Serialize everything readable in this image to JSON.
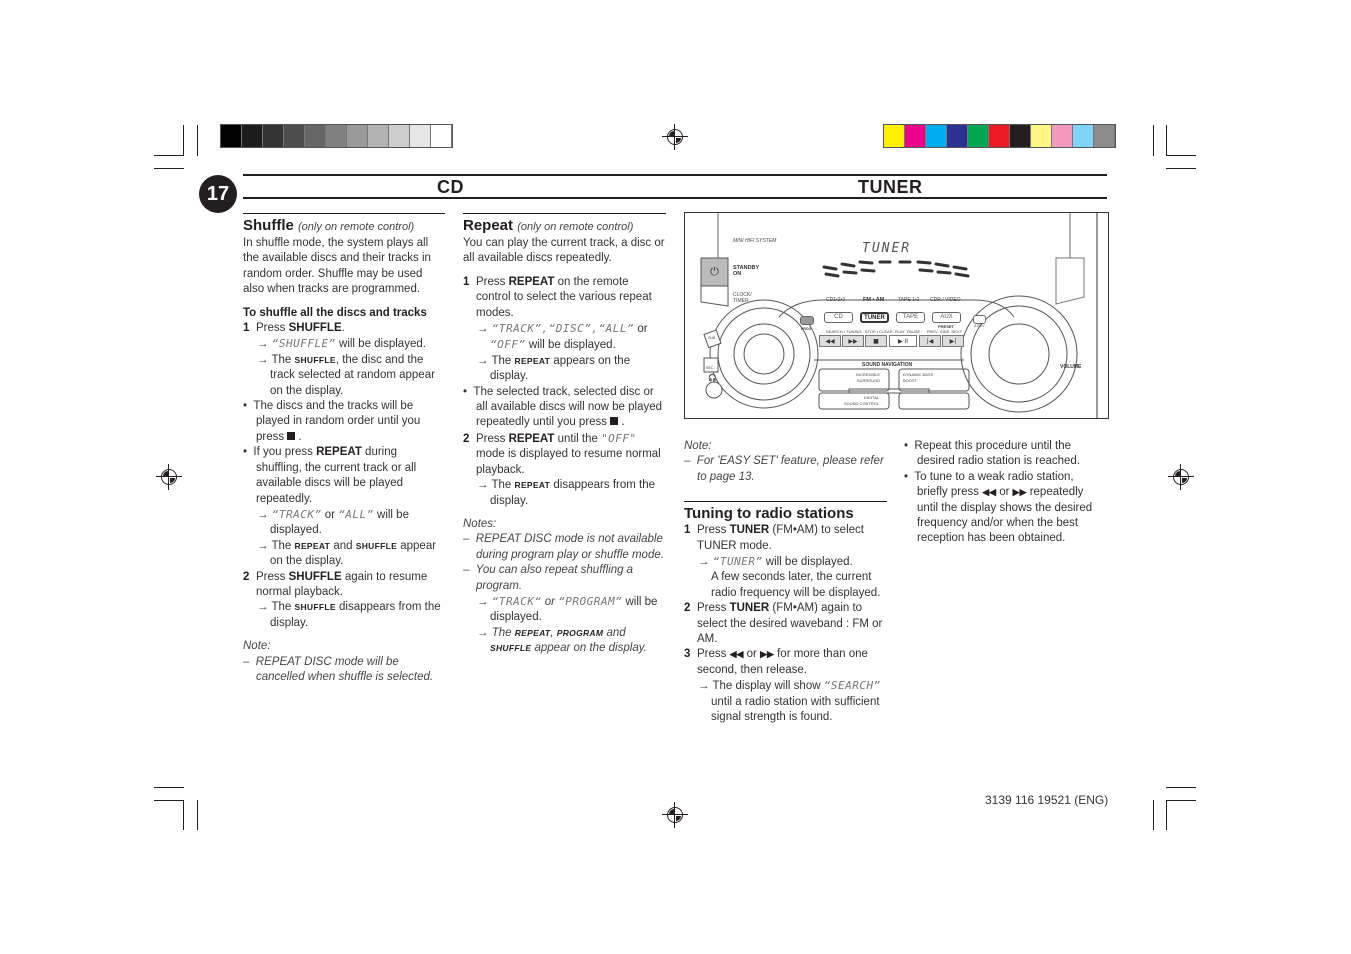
{
  "print_marks": {
    "grayscale_swatches": [
      "#000000",
      "#1c1c1c",
      "#333333",
      "#4d4d4d",
      "#666666",
      "#808080",
      "#999999",
      "#b3b3b3",
      "#cccccc",
      "#e6e6e6",
      "#ffffff"
    ],
    "color_swatches": [
      "#fff200",
      "#ec008c",
      "#00aeef",
      "#2e3192",
      "#00a651",
      "#ed1c24",
      "#231f20",
      "#fff685",
      "#f49ac1",
      "#7fd4f7",
      "#8c8c8c"
    ]
  },
  "header": {
    "page_number": "17",
    "left_title": "CD",
    "right_title": "TUNER"
  },
  "shuffle": {
    "title": "Shuffle",
    "subtitle": "(only on remote control)",
    "intro": "In shuffle mode, the system plays all the available discs and their tracks in random order. Shuffle may be used also when tracks are programmed.",
    "subheading": "To shuffle all the discs and tracks",
    "step1_num": "1",
    "step1_pre": "Press ",
    "step1_key": "SHUFFLE",
    "step1_post": ".",
    "step1_a1_lcd": "“SHUFFLE”",
    "step1_a1_post": " will be displayed.",
    "step1_a2_pre": "The ",
    "step1_a2_sc": "SHUFFLE",
    "step1_a2_post": ", the disc and the track selected at random appear on the display.",
    "bullet1": "The discs and the tracks will be played in random order until you press ",
    "bullet2_pre": "If you press ",
    "bullet2_key": "REPEAT",
    "bullet2_post": " during shuffling, the current track or all available discs will be played repeatedly.",
    "bullet2_a1_lcd1": "“TRACK”",
    "bullet2_a1_or": " or ",
    "bullet2_a1_lcd2": "“ALL”",
    "bullet2_a1_post": " will be displayed.",
    "bullet2_a2_pre": "The ",
    "bullet2_a2_sc1": "REPEAT",
    "bullet2_a2_and": " and ",
    "bullet2_a2_sc2": "SHUFFLE",
    "bullet2_a2_post": " appear on the display.",
    "step2_num": "2",
    "step2_pre": "Press ",
    "step2_key": "SHUFFLE",
    "step2_post": " again to resume normal playback.",
    "step2_a1_pre": "The ",
    "step2_a1_sc": "SHUFFLE",
    "step2_a1_post": " disappears from the display.",
    "note_label": "Note:",
    "note1": "REPEAT DISC mode will be cancelled when shuffle is selected."
  },
  "repeat": {
    "title": "Repeat",
    "subtitle": "(only on remote control)",
    "intro": "You can play the current track, a disc or all available discs repeatedly.",
    "step1_num": "1",
    "step1_pre": "Press ",
    "step1_key": "REPEAT",
    "step1_post": " on the remote control to select the various repeat modes.",
    "step1_a1_lcd": "“TRACK”,“DISC”,“ALL”",
    "step1_a1_or": " or ",
    "step1_a1_lcd2": "“OFF”",
    "step1_a1_post": " will be displayed.",
    "step1_a2_pre": "The ",
    "step1_a2_sc": "REPEAT",
    "step1_a2_post": " appears on the display.",
    "bullet1": "The selected track, selected disc or all available discs will now be played repeatedly until you press ",
    "step2_num": "2",
    "step2_pre": "Press ",
    "step2_key": "REPEAT",
    "step2_mid": " until the ",
    "step2_lcd": "\"OFF\"",
    "step2_post": " mode is displayed to resume normal playback.",
    "step2_a1_pre": "The ",
    "step2_a1_sc": "REPEAT",
    "step2_a1_post": " disappears from the display.",
    "notes_label": "Notes:",
    "note1": "REPEAT DISC mode is not available during program play or shuffle mode.",
    "note2": "You can also repeat shuffling a program.",
    "note2_a1_lcd1": "“TRACK“",
    "note2_a1_or": " or ",
    "note2_a1_lcd2": "“PROGRAM”",
    "note2_a1_post": " will be displayed.",
    "note2_a2_pre": "The ",
    "note2_a2_sc1": "REPEAT",
    "note2_a2_comma": ", ",
    "note2_a2_sc2": "PROGRAM",
    "note2_a2_and": " and ",
    "note2_a2_sc3": "SHUFFLE",
    "note2_a2_post": " appear on the display."
  },
  "device": {
    "brand_text": "MINI HIFI SYSTEM",
    "display_text": "TUNER",
    "standby_label": "STANDBY\nON",
    "clock_label": "CLOCK/\nTIMER",
    "source_labels": [
      "CD1•2•3",
      "FM • AM",
      "TAPE 1•2",
      "CDR / VIDEO"
    ],
    "source_buttons": [
      "CD",
      "TUNER",
      "TAPE",
      "AUX"
    ],
    "prog_label": "PROG",
    "arev_label": "A.REV",
    "preset_label": "PRESET",
    "transport_labels": "SEARCH • TUNING   STOP • CLEAR  PLAY  PAUSE      PREV  SIDE  NEXT",
    "transport_buttons": [
      "◀◀",
      "▶▶",
      "■",
      "▶  II",
      "|◀",
      "▶|"
    ],
    "sound_navigation": "SOUND NAVIGATION",
    "incredible_surround": "INCREDIBLE\nSURROUND",
    "dynamic_bass": "DYNAMIC BASS\nBOOST",
    "digital_sound": "DIGITAL\nSOUND CONTROL",
    "dub_label": "DUB",
    "rec_label": "REC",
    "volume_label": "VOLUME"
  },
  "tuner": {
    "note_label": "Note:",
    "note1": "For 'EASY SET' feature, please refer to page 13.",
    "title": "Tuning to radio stations",
    "step1_num": "1",
    "step1_pre": "Press ",
    "step1_key": "TUNER",
    "step1_post": " (FM•AM) to select TUNER mode.",
    "step1_a1_lcd": "“TUNER”",
    "step1_a1_post": " will be displayed.",
    "step1_a1_cont": "A few seconds later, the current radio frequency will be displayed.",
    "step2_num": "2",
    "step2_pre": "Press ",
    "step2_key": "TUNER",
    "step2_post": " (FM•AM) again to select the desired waveband : FM or AM.",
    "step3_num": "3",
    "step3_pre": "Press ",
    "step3_rew": "◀◀",
    "step3_or": " or ",
    "step3_ff": "▶▶",
    "step3_post": " for more than one second, then release.",
    "step3_a1_pre": "The display will show ",
    "step3_a1_lcd": "“SEARCH”",
    "step3_a1_post": " until a radio station with sufficient signal strength is found.",
    "bullet1": "Repeat this procedure until the desired radio station is reached.",
    "bullet2_pre": "To tune to a weak radio station, briefly press ",
    "bullet2_rew": "◀◀",
    "bullet2_or": " or ",
    "bullet2_ff": "▶▶",
    "bullet2_post": " repeatedly until the display shows the desired frequency and/or when the best reception has been obtained."
  },
  "footer": {
    "code": "3139 116 19521 (ENG)"
  }
}
